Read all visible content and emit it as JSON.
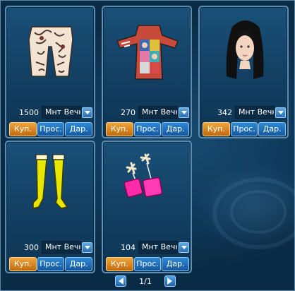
{
  "items": [
    {
      "price": "1500",
      "duration": "Мнт Вечн",
      "image": "tattooed-pants-icon",
      "buy_label": "Куп.",
      "view_label": "Прос.",
      "gift_label": "Дар."
    },
    {
      "price": "270",
      "duration": "Мнт Вечн",
      "image": "pop-art-dress-icon",
      "buy_label": "Куп.",
      "view_label": "Прос.",
      "gift_label": "Дар."
    },
    {
      "price": "342",
      "duration": "Мнт Вечн",
      "image": "black-hair-icon",
      "buy_label": "Куп.",
      "view_label": "Прос.",
      "gift_label": "Дар."
    },
    {
      "price": "300",
      "duration": "Мнт Вечн",
      "image": "yellow-stockings-icon",
      "buy_label": "Куп.",
      "view_label": "Прос.",
      "gift_label": "Дар."
    },
    {
      "price": "104",
      "duration": "Мнт Вечн",
      "image": "pink-earrings-icon",
      "buy_label": "Куп.",
      "view_label": "Прос.",
      "gift_label": "Дар."
    }
  ],
  "pagination": {
    "label": "1/1"
  },
  "colors": {
    "buy": "#e08a1e",
    "action": "#2272bd",
    "panel": "#123f62",
    "border": "#5d8db1"
  }
}
